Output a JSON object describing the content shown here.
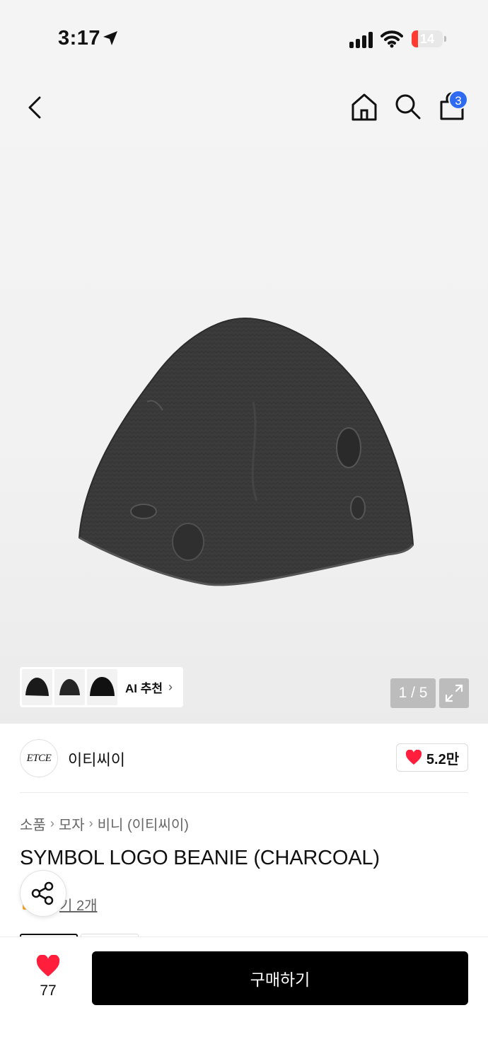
{
  "status_bar": {
    "time": "3:17",
    "battery": "14",
    "battery_level_percent": 14
  },
  "nav": {
    "back_icon": "chevron-left-icon",
    "home_icon": "home-icon",
    "search_icon": "search-icon",
    "cart_icon": "shopping-bag-icon",
    "cart_badge": "3"
  },
  "gallery": {
    "counter": "1 / 5",
    "expand_icon": "expand-icon",
    "ai_recommend": {
      "label": "AI 추천",
      "chevron": "›"
    }
  },
  "brand": {
    "logo_text": "ETCE",
    "name": "이티씨이",
    "likes": "5.2만"
  },
  "breadcrumb": {
    "items": [
      "소품",
      "모자",
      "비니 (이티씨이)"
    ],
    "separator": "›"
  },
  "product": {
    "title": "SYMBOL LOGO BEANIE (CHARCOAL)",
    "review_link": "후기 2개",
    "review_link_visible": "기 2개"
  },
  "bottom_bar": {
    "wish_count": "77",
    "buy_label": "구매하기"
  },
  "colors": {
    "heart": "#ff1f3d",
    "badge": "#2f6bf2",
    "buy_button": "#000000",
    "beanie": "#3a3a3a"
  }
}
